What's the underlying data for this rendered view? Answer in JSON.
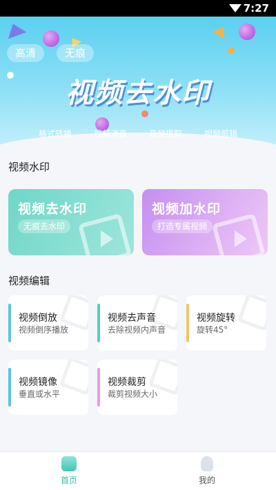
{
  "status": {
    "time": "7:27"
  },
  "banner": {
    "pill_hd": "高清",
    "pill_no_trace": "无痕",
    "title": "视频去水印",
    "tags": [
      "格式转换",
      "视频消音",
      "音频提取",
      "视频剪辑"
    ]
  },
  "sections": {
    "watermark": "视频水印",
    "edit": "视频编辑"
  },
  "cards": [
    {
      "title": "视频去水印",
      "subtitle": "无痕去水印"
    },
    {
      "title": "视频加水印",
      "subtitle": "打造专属视频"
    }
  ],
  "tools": [
    {
      "title": "视频倒放",
      "subtitle": "视频倒序播放",
      "accent": "#5bc6dc"
    },
    {
      "title": "视频去声音",
      "subtitle": "去除视频内声音",
      "accent": "#55d0c0"
    },
    {
      "title": "视频旋转",
      "subtitle": "旋转45°",
      "accent": "#f0c56b"
    },
    {
      "title": "视频镜像",
      "subtitle": "垂直或水平",
      "accent": "#58c3e0"
    },
    {
      "title": "视频裁剪",
      "subtitle": "裁剪视频大小",
      "accent": "#e99be8"
    }
  ],
  "tabbar": {
    "home": "首页",
    "me": "我的",
    "active_color": "#3ab8a8"
  }
}
